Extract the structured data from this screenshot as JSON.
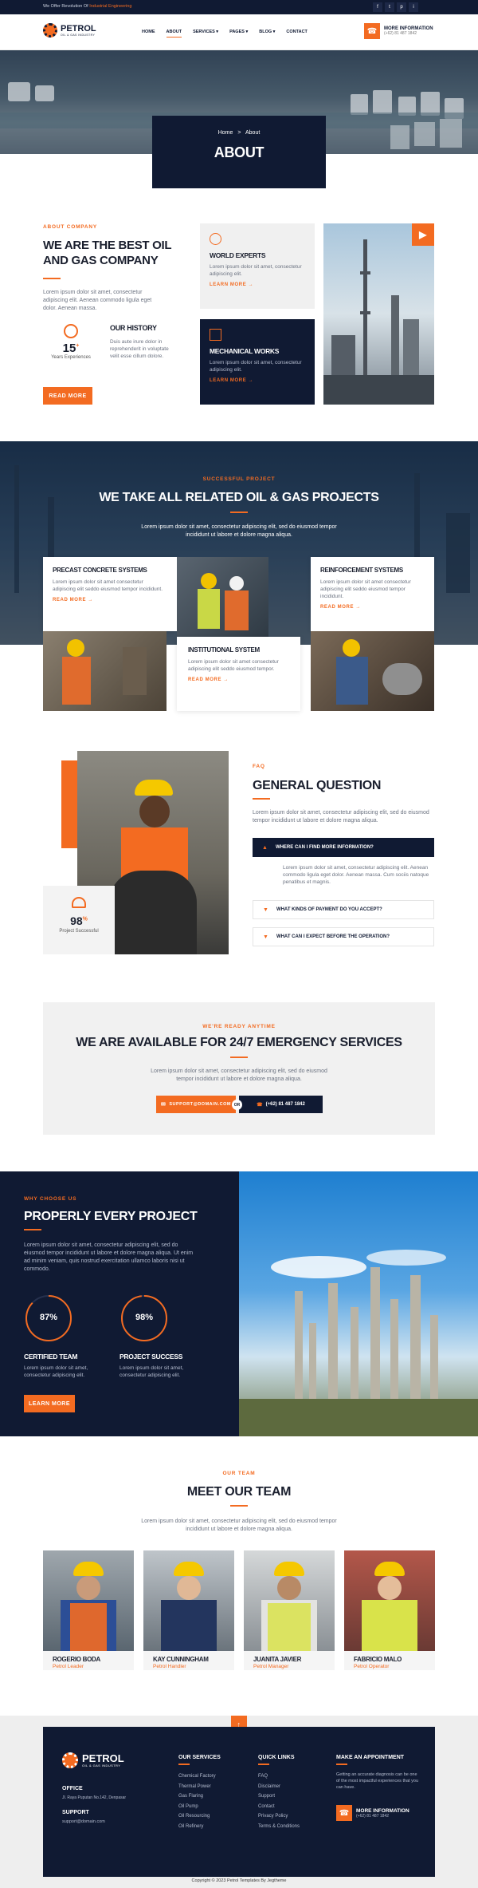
{
  "topbar": {
    "welcome": "We Offer Revolution Of",
    "highlight": "Industrial Engineering",
    "social": [
      "f",
      "t",
      "p",
      "i"
    ]
  },
  "header": {
    "logo": "PETROL",
    "logo_sub": "OIL & GAS INDUSTRY",
    "nav": [
      "HOME",
      "ABOUT",
      "SERVICES",
      "PAGES",
      "BLOG",
      "CONTACT"
    ],
    "info_title": "MORE INFORMATION",
    "info_phone": "(+62) 81 487 1842"
  },
  "banner": {
    "crumb_home": "Home",
    "crumb_sep": ">",
    "crumb_current": "About",
    "title": "ABOUT"
  },
  "about": {
    "tag": "ABOUT COMPANY",
    "title": "WE ARE THE BEST OIL AND GAS COMPANY",
    "text": "Lorem ipsum dolor sit amet, consectetur adipiscing elit. Aenean commodo ligula eget dolor. Aenean massa.",
    "exp_num": "15",
    "exp_sup": "+",
    "exp_label": "Years Experiences",
    "history_title": "OUR HISTORY",
    "history_text": "Duis aute irure dolor in reprehenderit in voluptate velit esse cillum dolore.",
    "btn": "READ MORE",
    "card1_title": "WORLD EXPERTS",
    "card1_text": "Lorem ipsum dolor sit amet, consectetur adipiscing elit.",
    "card1_link": "LEARN MORE",
    "card2_title": "MECHANICAL WORKS",
    "card2_text": "Lorem ipsum dolor sit amet, consectetur adipiscing elit.",
    "card2_link": "LEARN MORE"
  },
  "projects": {
    "tag": "SUCCESSFUL PROJECT",
    "title": "WE TAKE ALL RELATED OIL & GAS PROJECTS",
    "text": "Lorem ipsum dolor sit amet, consectetur adipiscing elit, sed do eiusmod tempor incididunt ut labore et dolore magna aliqua.",
    "items": [
      {
        "title": "PRECAST CONCRETE SYSTEMS",
        "text": "Lorem ipsum dolor sit amet consectetur adipiscing elit seddo eiusmod tempor incididunt.",
        "link": "READ MORE"
      },
      {
        "title": "INSTITUTIONAL SYSTEM",
        "text": "Lorem ipsum dolor sit amet consectetur adipiscing elit seddo eiusmod tempor.",
        "link": "READ MORE"
      },
      {
        "title": "REINFORCEMENT SYSTEMS",
        "text": "Lorem ipsum dolor sit amet consectetur adipiscing elit seddo eiusmod tempor incididunt.",
        "link": "READ MORE"
      }
    ]
  },
  "faq": {
    "tag": "FAQ",
    "title": "GENERAL QUESTION",
    "text": "Lorem ipsum dolor sit amet, consectetur adipiscing elit, sed do eiusmod tempor incididunt ut labore et dolore magna aliqua.",
    "q1": "WHERE CAN I FIND MORE INFORMATION?",
    "a1": "Lorem ipsum dolor sit amet, consectetur adipiscing elit. Aenean commodo ligula eget dolor. Aenean massa. Cum sociis natoque penatibus et magnis.",
    "q2": "WHAT KINDS OF PAYMENT DO YOU ACCEPT?",
    "q3": "WHAT CAN I EXPECT BEFORE THE OPERATION?",
    "stat_num": "98",
    "stat_sup": "%",
    "stat_label": "Project Successful"
  },
  "emergency": {
    "tag": "WE'RE READY ANYTIME",
    "title": "WE ARE AVAILABLE FOR 24/7 EMERGENCY SERVICES",
    "text": "Lorem ipsum dolor sit amet, consectetur adipiscing elit, sed do eiusmod tempor incididunt ut labore et dolore magna aliqua.",
    "email": "SUPPORT@DOMAIN.COM",
    "or": "OR",
    "phone": "(+62) 81 487 1842"
  },
  "why": {
    "tag": "WHY CHOOSE US",
    "title": "PROPERLY EVERY PROJECT",
    "text": "Lorem ipsum dolor sit amet, consectetur adipiscing elit, sed do eiusmod tempor incididunt ut labore et dolore magna aliqua. Ut enim ad minim veniam, quis nostrud exercitation ullamco laboris nisi ut commodo.",
    "c1_val": "87%",
    "c1_pct": 87,
    "c1_title": "CERTIFIED TEAM",
    "c1_text": "Lorem ipsum dolor sit amet, consectetur adipiscing elit.",
    "c2_val": "98%",
    "c2_pct": 98,
    "c2_title": "PROJECT SUCCESS",
    "c2_text": "Lorem ipsum dolor sit amet, consectetur adipiscing elit.",
    "btn": "LEARN MORE"
  },
  "team": {
    "tag": "OUR TEAM",
    "title": "MEET OUR TEAM",
    "text": "Lorem ipsum dolor sit amet, consectetur adipiscing elit, sed do eiusmod tempor incididunt ut labore et dolore magna aliqua.",
    "members": [
      {
        "name": "ROGERIO BODA",
        "role": "Petrol Leader"
      },
      {
        "name": "KAY CUNNINGHAM",
        "role": "Petrol Handler"
      },
      {
        "name": "JUANITA JAVIER",
        "role": "Petrol Manager"
      },
      {
        "name": "FABRICIO MALO",
        "role": "Petrol Operator"
      }
    ]
  },
  "footer": {
    "logo": "PETROL",
    "logo_sub": "OIL & GAS INDUSTRY",
    "office_title": "OFFICE",
    "office_text": "Jl. Raya Puputan No.142, Denpasar",
    "support_title": "SUPPORT",
    "support_text": "support@domain.com",
    "services_title": "OUR SERVICES",
    "services": [
      "Chemical Factory",
      "Thermal Power",
      "Gas Flaring",
      "Oil Pump",
      "Oil Resourcing",
      "Oil Refinery"
    ],
    "links_title": "QUICK LINKS",
    "links": [
      "FAQ",
      "Disclaimer",
      "Support",
      "Contact",
      "Privacy Policy",
      "Terms & Conditions"
    ],
    "appt_title": "MAKE AN APPOINTMENT",
    "appt_text": "Getting an accurate diagnosis can be one of the most impactful experiences that you can have.",
    "info_title": "MORE INFORMATION",
    "info_phone": "(+62) 81 487 1842",
    "copyright": "Copyright © 2023 Petrol Templates By Jegtheme"
  },
  "colors": {
    "accent": "#f36b21",
    "navy": "#101a33"
  }
}
